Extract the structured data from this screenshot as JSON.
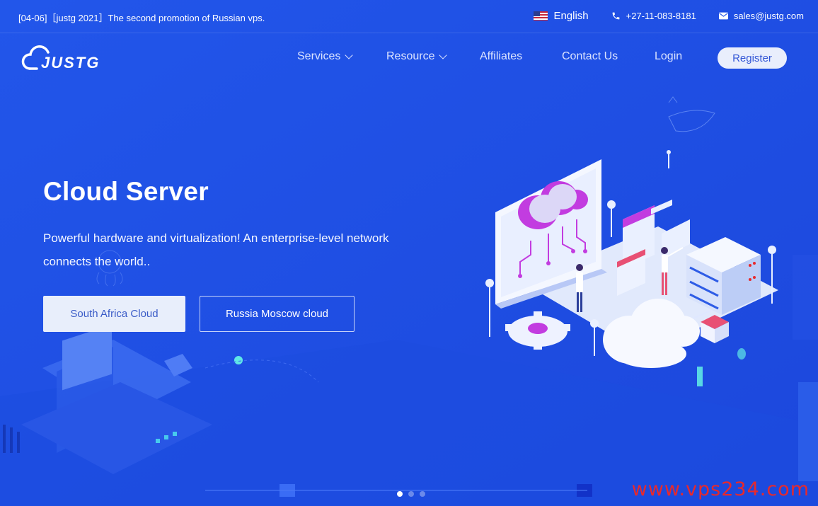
{
  "topbar": {
    "promo": "[04-06]［justg 2021］The second promotion of Russian vps.",
    "language": "English",
    "phone": "+27-11-083-8181",
    "email": "sales@justg.com"
  },
  "brand": {
    "logo_text": "JUSTG"
  },
  "nav": {
    "items": [
      {
        "label": "Services",
        "dropdown": true
      },
      {
        "label": "Resource",
        "dropdown": true
      },
      {
        "label": "Affiliates",
        "dropdown": false
      },
      {
        "label": "Contact Us",
        "dropdown": false
      },
      {
        "label": "Login",
        "dropdown": false
      }
    ],
    "register": "Register"
  },
  "hero": {
    "title": "Cloud Server",
    "subtitle": "Powerful hardware and virtualization! An enterprise-level network connects the world..",
    "primary_button": "South Africa Cloud",
    "secondary_button": "Russia Moscow cloud"
  },
  "carousel": {
    "total": 3,
    "active": 1
  },
  "watermark": "www.vps234.com",
  "colors": {
    "background": "#1f51e6",
    "accent_magenta": "#c23ce0",
    "register_bg": "#e9eefc"
  },
  "icons": [
    "us-flag-icon",
    "phone-icon",
    "mail-icon",
    "chevron-down-icon",
    "cloud-logo-icon"
  ]
}
